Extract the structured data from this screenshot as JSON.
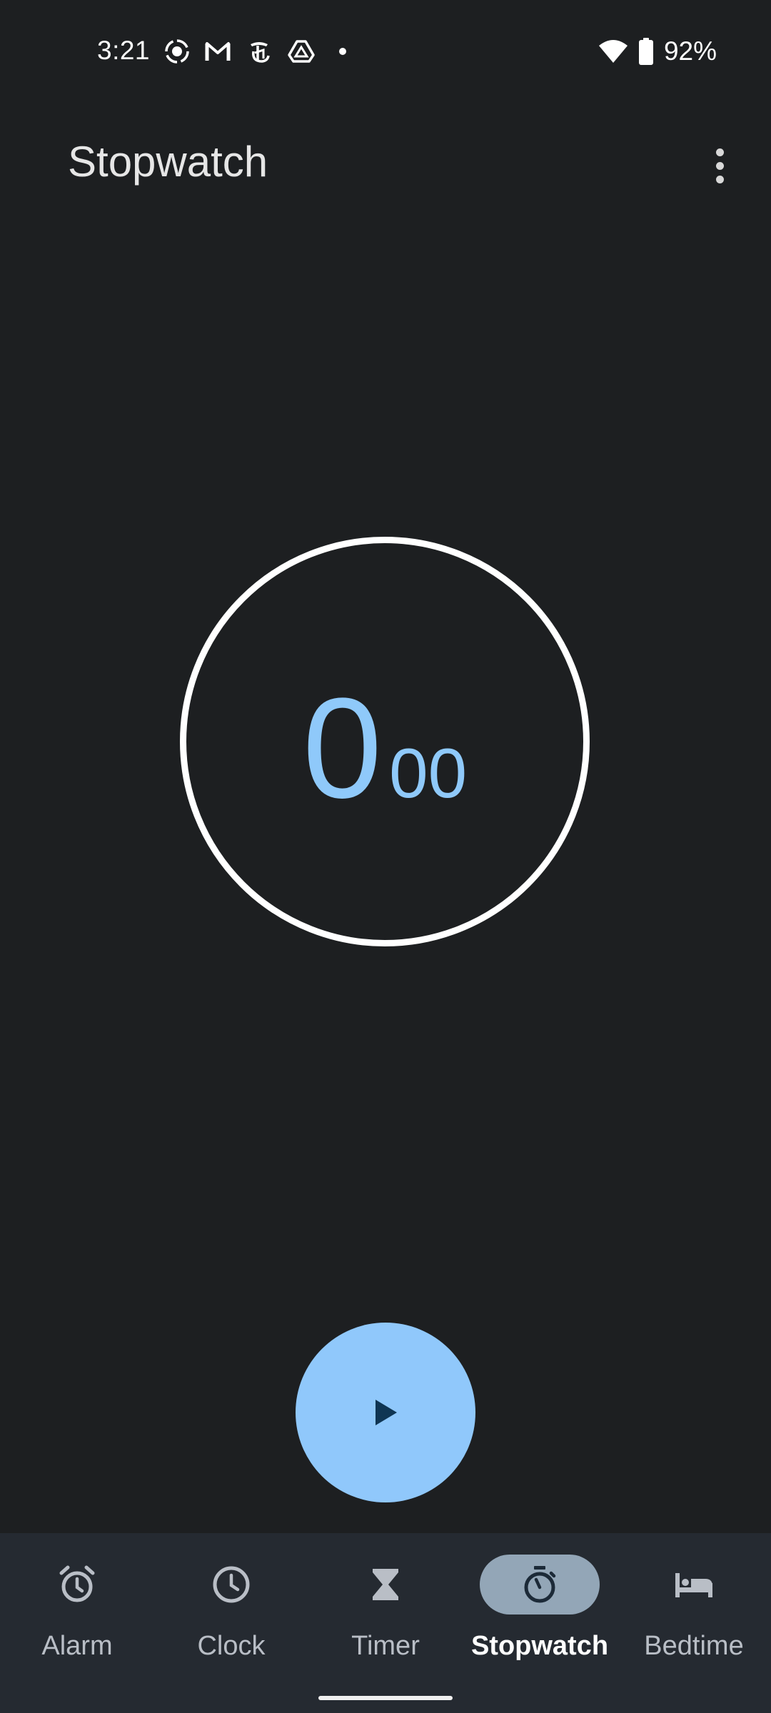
{
  "status_bar": {
    "time": "3:21",
    "battery_percent": "92%",
    "notification_icons": [
      "screen-record-icon",
      "gmail-icon",
      "nytimes-icon",
      "drive-icon",
      "more-notifications-dot-icon"
    ],
    "system_icons": [
      "wifi-icon",
      "battery-icon"
    ]
  },
  "app_bar": {
    "title": "Stopwatch",
    "menu_icon": "more-vert-icon"
  },
  "stopwatch": {
    "seconds": "0",
    "hundredths": "00",
    "accent_color": "#8fc9fa",
    "ring_color": "#ffffff"
  },
  "controls": {
    "start_icon": "play-icon",
    "fab_color": "#90c8fb"
  },
  "bottom_nav": {
    "selected": "Stopwatch",
    "items": [
      {
        "label": "Alarm",
        "icon": "alarm-icon"
      },
      {
        "label": "Clock",
        "icon": "clock-icon"
      },
      {
        "label": "Timer",
        "icon": "hourglass-icon"
      },
      {
        "label": "Stopwatch",
        "icon": "stopwatch-icon"
      },
      {
        "label": "Bedtime",
        "icon": "bed-icon"
      }
    ]
  },
  "colors": {
    "background": "#1d1f21",
    "nav_background": "#252a31",
    "active_pill": "#93a6b7"
  }
}
